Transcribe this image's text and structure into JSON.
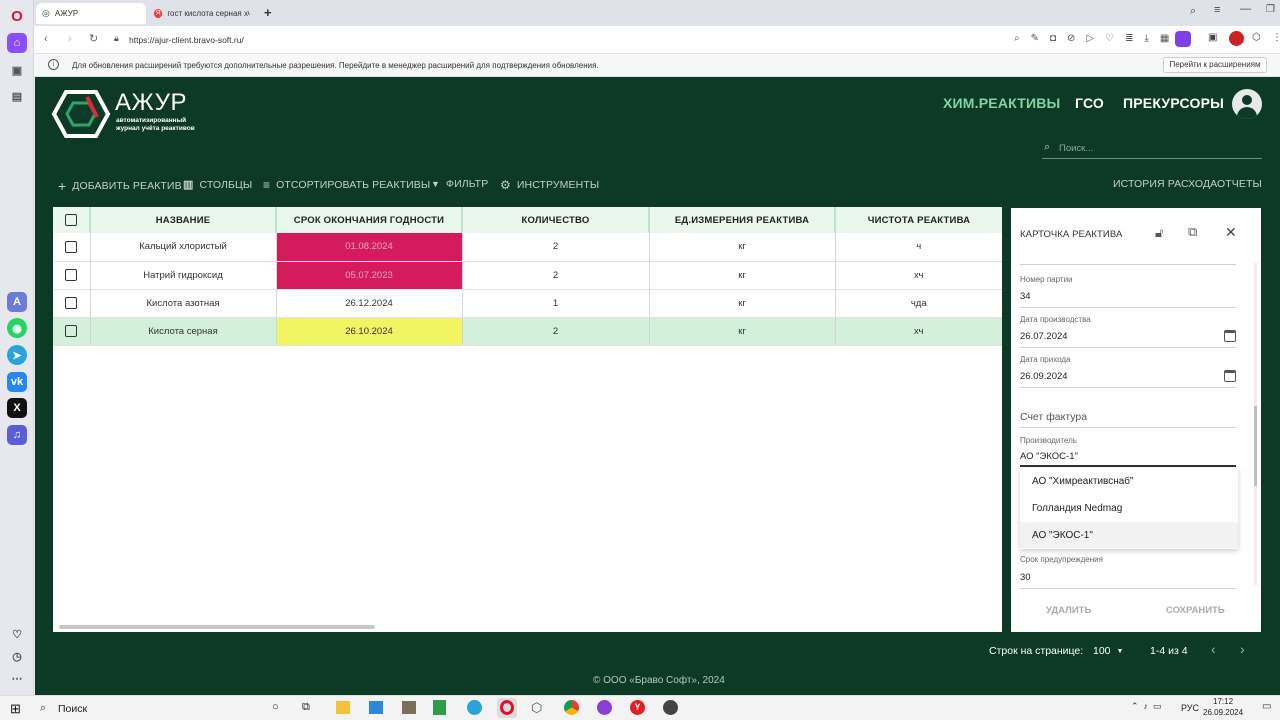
{
  "browser": {
    "tabs": [
      {
        "title": "АЖУР"
      },
      {
        "title": "гост кислота серная хч -"
      }
    ],
    "url": "https://ajur-client.bravo-soft.ru/",
    "notification": "Для обновления расширений требуются дополнительные разрешения. Перейдите в менеджер расширений для подтверждения обновления.",
    "notification_button": "Перейти к расширениям"
  },
  "app": {
    "logo": {
      "name": "АЖУР",
      "tagline_1": "автоматизированный",
      "tagline_2": "журнал учёта реактивов"
    },
    "nav": [
      {
        "label": "ХИМ.РЕАКТИВЫ",
        "active": true
      },
      {
        "label": "ГСО"
      },
      {
        "label": "ПРЕКУРСОРЫ"
      }
    ],
    "search_placeholder": "Поиск...",
    "toolbar": {
      "add": "ДОБАВИТЬ РЕАКТИВ",
      "columns": "СТОЛБЦЫ",
      "sort": "ОТСОРТИРОВАТЬ РЕАКТИВЫ",
      "filter": "ФИЛЬТР",
      "tools": "ИНСТРУМЕНТЫ",
      "history": "ИСТОРИЯ РАСХОДА",
      "reports": "ОТЧЕТЫ"
    },
    "table": {
      "headers": [
        "НАЗВАНИЕ",
        "СРОК ОКОНЧАНИЯ ГОДНОСТИ",
        "КОЛИЧЕСТВО",
        "ЕД.ИЗМЕРЕНИЯ РЕАКТИВА",
        "ЧИСТОТА РЕАКТИВА"
      ],
      "rows": [
        {
          "name": "Кальций хлористый",
          "expiry": "01.08.2024",
          "qty": "2",
          "unit": "кг",
          "purity": "ч",
          "status": "expired"
        },
        {
          "name": "Натрий гидроксид",
          "expiry": "05.07.2023",
          "qty": "2",
          "unit": "кг",
          "purity": "хч",
          "status": "expired"
        },
        {
          "name": "Кислота азотная",
          "expiry": "26.12.2024",
          "qty": "1",
          "unit": "кг",
          "purity": "чда",
          "status": "ok"
        },
        {
          "name": "Кислота серная",
          "expiry": "26.10.2024",
          "qty": "2",
          "unit": "кг",
          "purity": "хч",
          "status": "warning",
          "selected": true
        }
      ]
    },
    "card": {
      "title": "КАРТОЧКА РЕАКТИВА",
      "batch_label": "Номер партии",
      "batch": "34",
      "prod_date_label": "Дата производства",
      "prod_date": "26.07.2024",
      "arrival_label": "Дата прихода",
      "arrival": "26.09.2024",
      "invoice_label": "Счет фактура",
      "manufacturer_label": "Производитель",
      "manufacturer": "АО \"ЭКОС-1\"",
      "options": [
        "АО \"Химреактивснаб\"",
        "Голландия Nedmag",
        "АО \"ЭКОС-1\""
      ],
      "warning_label": "Срок предупреждения",
      "warning_value": "30",
      "delete": "УДАЛИТЬ",
      "save": "СОХРАНИТЬ"
    },
    "pagination": {
      "rows_label": "Строк на странице:",
      "rows_value": "100",
      "range": "1-4 из 4"
    },
    "footer": "© ООО «Браво Софт», 2024"
  },
  "colors": {
    "app_bg": "#0c3a27",
    "nav_active": "#7ed89f",
    "expired": "#d41c5c",
    "warning": "#f2f562",
    "selected_row": "#d3f0db"
  },
  "taskbar": {
    "search": "Поиск",
    "lang": "РУС",
    "time": "17:12",
    "date": "26.09.2024"
  }
}
